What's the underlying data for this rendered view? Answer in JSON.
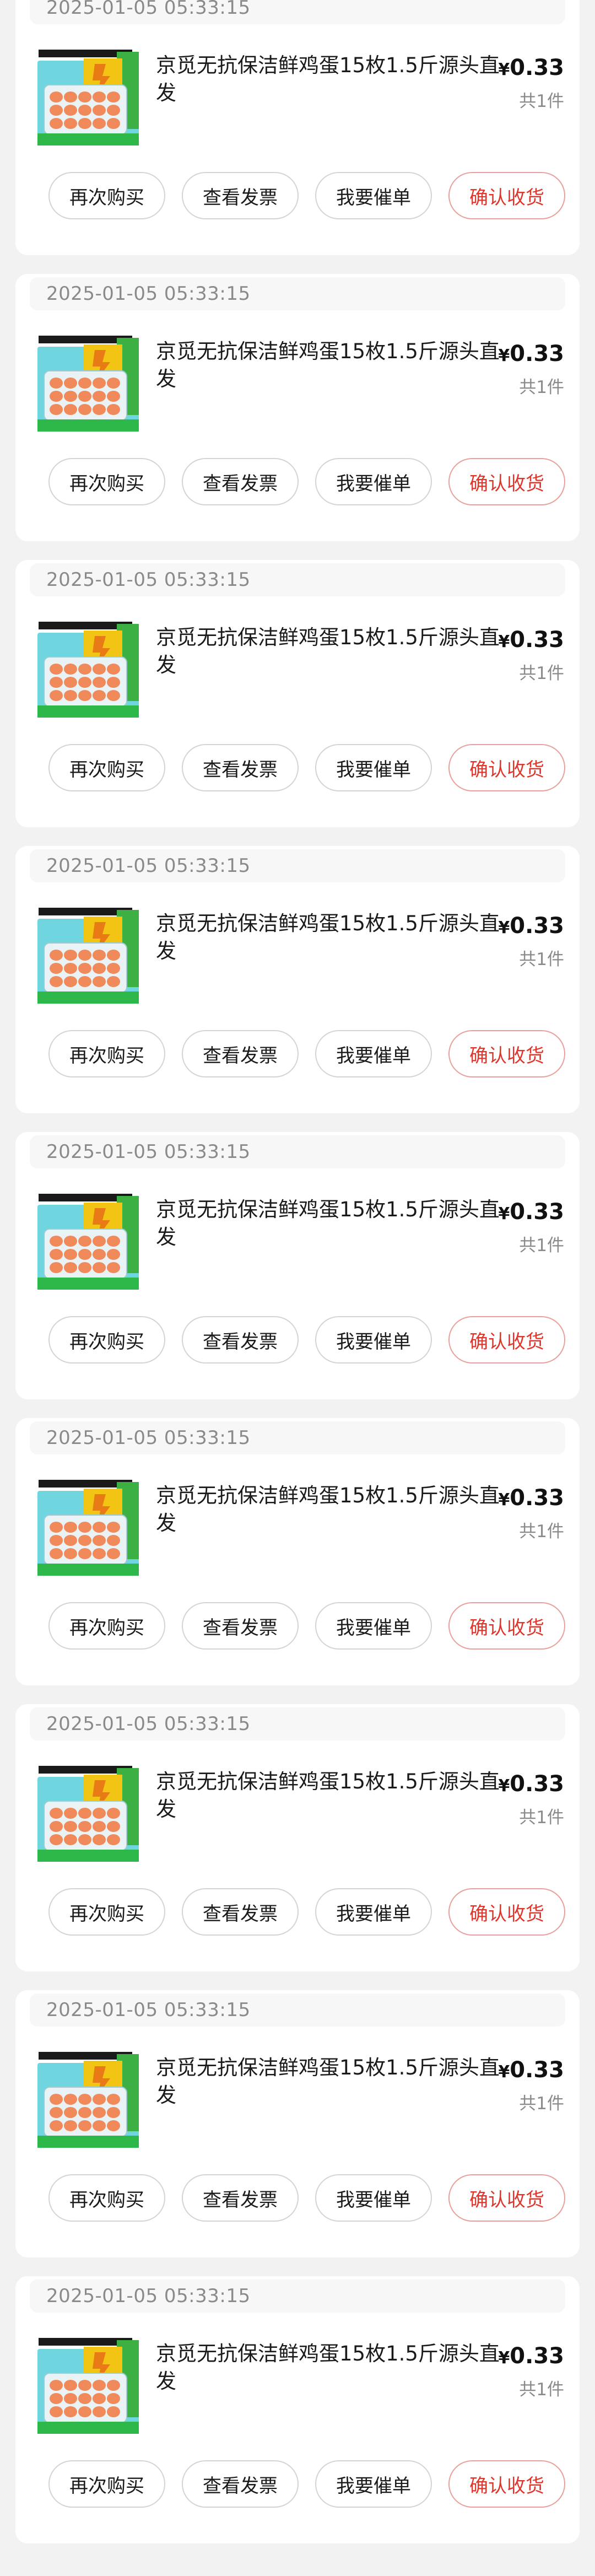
{
  "order_list": {
    "orders": [
      {
        "date": "2025-01-05 05:33:15",
        "title": "京觅无抗保洁鲜鸡蛋15枚1.5斤源头直发",
        "price_symbol": "¥",
        "price": "0.33",
        "quantity": "共1件",
        "actions": {
          "rebuy": "再次购买",
          "invoice": "查看发票",
          "urge": "我要催单",
          "confirm": "确认收货"
        }
      },
      {
        "date": "2025-01-05 05:33:15",
        "title": "京觅无抗保洁鲜鸡蛋15枚1.5斤源头直发",
        "price_symbol": "¥",
        "price": "0.33",
        "quantity": "共1件",
        "actions": {
          "rebuy": "再次购买",
          "invoice": "查看发票",
          "urge": "我要催单",
          "confirm": "确认收货"
        }
      },
      {
        "date": "2025-01-05 05:33:15",
        "title": "京觅无抗保洁鲜鸡蛋15枚1.5斤源头直发",
        "price_symbol": "¥",
        "price": "0.33",
        "quantity": "共1件",
        "actions": {
          "rebuy": "再次购买",
          "invoice": "查看发票",
          "urge": "我要催单",
          "confirm": "确认收货"
        }
      },
      {
        "date": "2025-01-05 05:33:15",
        "title": "京觅无抗保洁鲜鸡蛋15枚1.5斤源头直发",
        "price_symbol": "¥",
        "price": "0.33",
        "quantity": "共1件",
        "actions": {
          "rebuy": "再次购买",
          "invoice": "查看发票",
          "urge": "我要催单",
          "confirm": "确认收货"
        }
      },
      {
        "date": "2025-01-05 05:33:15",
        "title": "京觅无抗保洁鲜鸡蛋15枚1.5斤源头直发",
        "price_symbol": "¥",
        "price": "0.33",
        "quantity": "共1件",
        "actions": {
          "rebuy": "再次购买",
          "invoice": "查看发票",
          "urge": "我要催单",
          "confirm": "确认收货"
        }
      },
      {
        "date": "2025-01-05 05:33:15",
        "title": "京觅无抗保洁鲜鸡蛋15枚1.5斤源头直发",
        "price_symbol": "¥",
        "price": "0.33",
        "quantity": "共1件",
        "actions": {
          "rebuy": "再次购买",
          "invoice": "查看发票",
          "urge": "我要催单",
          "confirm": "确认收货"
        }
      },
      {
        "date": "2025-01-05 05:33:15",
        "title": "京觅无抗保洁鲜鸡蛋15枚1.5斤源头直发",
        "price_symbol": "¥",
        "price": "0.33",
        "quantity": "共1件",
        "actions": {
          "rebuy": "再次购买",
          "invoice": "查看发票",
          "urge": "我要催单",
          "confirm": "确认收货"
        }
      },
      {
        "date": "2025-01-05 05:33:15",
        "title": "京觅无抗保洁鲜鸡蛋15枚1.5斤源头直发",
        "price_symbol": "¥",
        "price": "0.33",
        "quantity": "共1件",
        "actions": {
          "rebuy": "再次购买",
          "invoice": "查看发票",
          "urge": "我要催单",
          "confirm": "确认收货"
        }
      },
      {
        "date": "2025-01-05 05:33:15",
        "title": "京觅无抗保洁鲜鸡蛋15枚1.5斤源头直发",
        "price_symbol": "¥",
        "price": "0.33",
        "quantity": "共1件",
        "actions": {
          "rebuy": "再次购买",
          "invoice": "查看发票",
          "urge": "我要催单",
          "confirm": "确认收货"
        }
      }
    ]
  },
  "colors": {
    "page_bg": "#f2f2f2",
    "card_bg": "#ffffff",
    "accent_red": "#e0352b",
    "muted_text": "#8a8a8a"
  },
  "icons": {
    "product_thumbnail": "egg-carton-product-image"
  }
}
